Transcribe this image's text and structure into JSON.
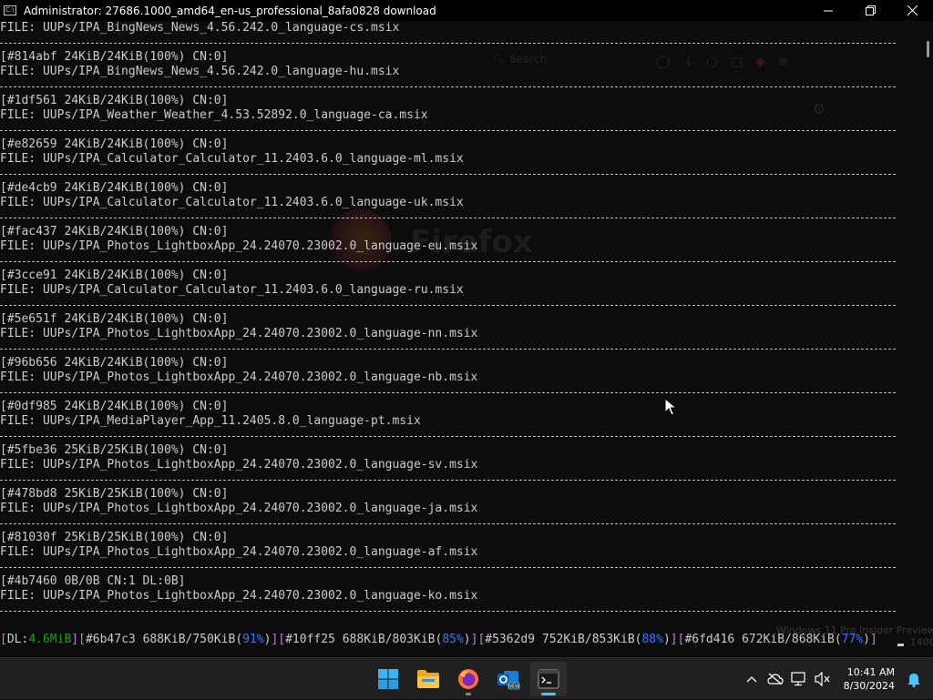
{
  "window": {
    "title": "Administrator:  27686.1000_amd64_en-us_professional_8afa0828 download"
  },
  "console": {
    "entries": [
      {
        "header": "",
        "file": "FILE: UUPs/IPA_BingNews_News_4.56.242.0_language-cs.msix"
      },
      {
        "header": "[#814abf 24KiB/24KiB(100%) CN:0]",
        "file": "FILE: UUPs/IPA_BingNews_News_4.56.242.0_language-hu.msix"
      },
      {
        "header": "[#1df561 24KiB/24KiB(100%) CN:0]",
        "file": "FILE: UUPs/IPA_Weather_Weather_4.53.52892.0_language-ca.msix"
      },
      {
        "header": "[#e82659 24KiB/24KiB(100%) CN:0]",
        "file": "FILE: UUPs/IPA_Calculator_Calculator_11.2403.6.0_language-ml.msix"
      },
      {
        "header": "[#de4cb9 24KiB/24KiB(100%) CN:0]",
        "file": "FILE: UUPs/IPA_Calculator_Calculator_11.2403.6.0_language-uk.msix"
      },
      {
        "header": "[#fac437 24KiB/24KiB(100%) CN:0]",
        "file": "FILE: UUPs/IPA_Photos_LightboxApp_24.24070.23002.0_language-eu.msix"
      },
      {
        "header": "[#3cce91 24KiB/24KiB(100%) CN:0]",
        "file": "FILE: UUPs/IPA_Calculator_Calculator_11.2403.6.0_language-ru.msix"
      },
      {
        "header": "[#5e651f 24KiB/24KiB(100%) CN:0]",
        "file": "FILE: UUPs/IPA_Photos_LightboxApp_24.24070.23002.0_language-nn.msix"
      },
      {
        "header": "[#96b656 24KiB/24KiB(100%) CN:0]",
        "file": "FILE: UUPs/IPA_Photos_LightboxApp_24.24070.23002.0_language-nb.msix"
      },
      {
        "header": "[#0df985 24KiB/24KiB(100%) CN:0]",
        "file": "FILE: UUPs/IPA_MediaPlayer_App_11.2405.8.0_language-pt.msix"
      },
      {
        "header": "[#5fbe36 25KiB/25KiB(100%) CN:0]",
        "file": "FILE: UUPs/IPA_Photos_LightboxApp_24.24070.23002.0_language-sv.msix"
      },
      {
        "header": "[#478bd8 25KiB/25KiB(100%) CN:0]",
        "file": "FILE: UUPs/IPA_Photos_LightboxApp_24.24070.23002.0_language-ja.msix"
      },
      {
        "header": "[#81030f 25KiB/25KiB(100%) CN:0]",
        "file": "FILE: UUPs/IPA_Photos_LightboxApp_24.24070.23002.0_language-af.msix"
      },
      {
        "header": "[#4b7460 0B/0B CN:1 DL:0B]",
        "file": "FILE: UUPs/IPA_Photos_LightboxApp_24.24070.23002.0_language-ko.msix"
      }
    ]
  },
  "status": {
    "dl_label": "DL:",
    "dl_speed": "4.6MiB",
    "downloads": [
      {
        "id": "#6b47c3",
        "progress": "688KiB/750KiB",
        "pct": "91%"
      },
      {
        "id": "#10ff25",
        "progress": "688KiB/803KiB",
        "pct": "85%"
      },
      {
        "id": "#5362d9",
        "progress": "752KiB/853KiB",
        "pct": "88%"
      },
      {
        "id": "#6fd416",
        "progress": "672KiB/868KiB",
        "pct": "77%"
      }
    ]
  },
  "background": {
    "firefox_word": "Firefox",
    "search_placeholder": "Search",
    "watermark_line1": "Windows 11 Pro Insider Preview",
    "watermark_line2": "1400"
  },
  "taskbar": {
    "apps": [
      {
        "name": "Start",
        "icon": "windows-logo-icon"
      },
      {
        "name": "File Explorer",
        "icon": "folder-icon"
      },
      {
        "name": "Firefox",
        "icon": "firefox-icon"
      },
      {
        "name": "Outlook (new)",
        "icon": "outlook-icon",
        "badge": "NEW"
      },
      {
        "name": "Terminal",
        "icon": "terminal-icon"
      }
    ],
    "tray": {
      "time": "10:41 AM",
      "date": "8/30/2024"
    }
  }
}
